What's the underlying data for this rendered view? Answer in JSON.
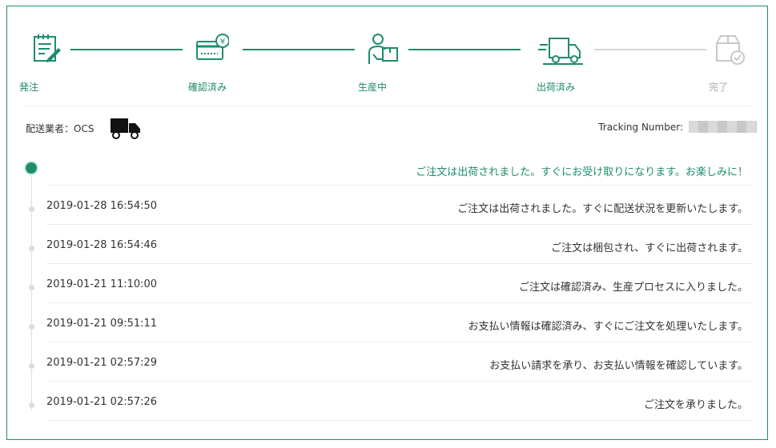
{
  "steps": [
    {
      "label": "発注",
      "icon": "order-document-icon",
      "active": true
    },
    {
      "label": "確認済み",
      "icon": "payment-card-icon",
      "active": true
    },
    {
      "label": "生産中",
      "icon": "worker-package-icon",
      "active": true
    },
    {
      "label": "出荷済み",
      "icon": "delivery-truck-icon",
      "active": true
    },
    {
      "label": "完了",
      "icon": "box-check-icon",
      "active": false
    }
  ],
  "carrier": {
    "label": "配送業者：OCS",
    "icon": "truck-icon"
  },
  "tracking": {
    "label": "Tracking Number:"
  },
  "timeline": [
    {
      "time": "",
      "message": "ご注文は出荷されました。すぐにお受け取りになります。お楽しみに！"
    },
    {
      "time": "2019-01-28 16:54:50",
      "message": "ご注文は出荷されました。すぐに配送状況を更新いたします。"
    },
    {
      "time": "2019-01-28 16:54:46",
      "message": "ご注文は梱包され、すぐに出荷されます。"
    },
    {
      "time": "2019-01-21 11:10:00",
      "message": "ご注文は確認済み、生産プロセスに入りました。"
    },
    {
      "time": "2019-01-21 09:51:11",
      "message": "お支払い情報は確認済み、すぐにご注文を処理いたします。"
    },
    {
      "time": "2019-01-21 02:57:29",
      "message": "お支払い請求を承り、お支払い情報を確認しています。"
    },
    {
      "time": "2019-01-21 02:57:26",
      "message": "ご注文を承りました。"
    }
  ],
  "colors": {
    "accent": "#1e8c6e",
    "inactive": "#c8c8c8"
  }
}
